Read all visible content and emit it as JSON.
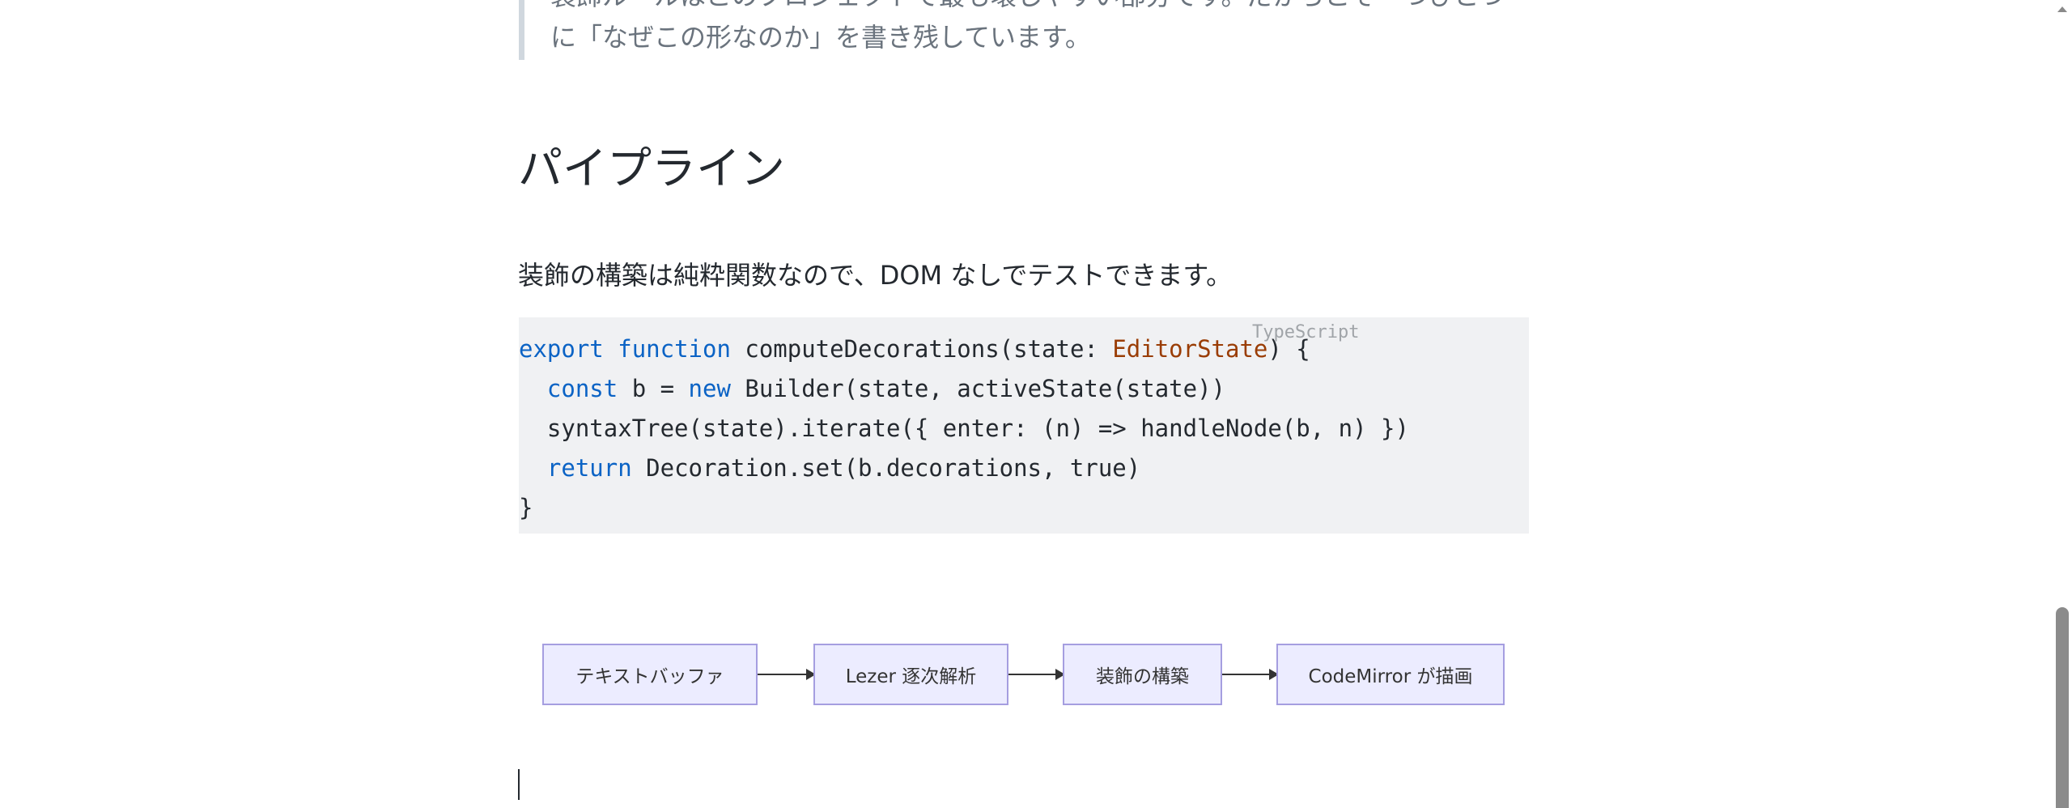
{
  "blockquote": {
    "line1": "装飾ルールはこのプロジェクトで最も壊しやすい部分です。だからこそ一つひとつ",
    "line2": "に「なぜこの形なのか」を書き残しています。"
  },
  "section": {
    "heading": "パイプライン",
    "paragraph": "装飾の構築は純粋関数なので、DOM なしでテストできます。"
  },
  "code": {
    "language": "TypeScript",
    "lines": [
      [
        {
          "t": "export",
          "c": "kw"
        },
        {
          "t": " "
        },
        {
          "t": "function",
          "c": "kw"
        },
        {
          "t": " computeDecorations(state: "
        },
        {
          "t": "EditorState",
          "c": "ty"
        },
        {
          "t": ") {"
        }
      ],
      [
        {
          "t": "  "
        },
        {
          "t": "const",
          "c": "kw"
        },
        {
          "t": " b = "
        },
        {
          "t": "new",
          "c": "kw"
        },
        {
          "t": " Builder(state, activeState(state))"
        }
      ],
      [
        {
          "t": "  syntaxTree(state).iterate({ enter: (n) => handleNode(b, n) })"
        }
      ],
      [
        {
          "t": "  "
        },
        {
          "t": "return",
          "c": "kw"
        },
        {
          "t": " Decoration.set(b.decorations, true)"
        }
      ],
      [
        {
          "t": "}"
        }
      ]
    ]
  },
  "diagram": {
    "nodes": [
      {
        "label": "テキストバッファ"
      },
      {
        "label": "Lezer 逐次解析"
      },
      {
        "label": "装飾の構築"
      },
      {
        "label": "CodeMirror が描画"
      }
    ]
  },
  "colors": {
    "keyword": "#0b63c5",
    "type": "#9a3d05",
    "node_fill": "#ececff",
    "node_border": "#a59ee0"
  }
}
